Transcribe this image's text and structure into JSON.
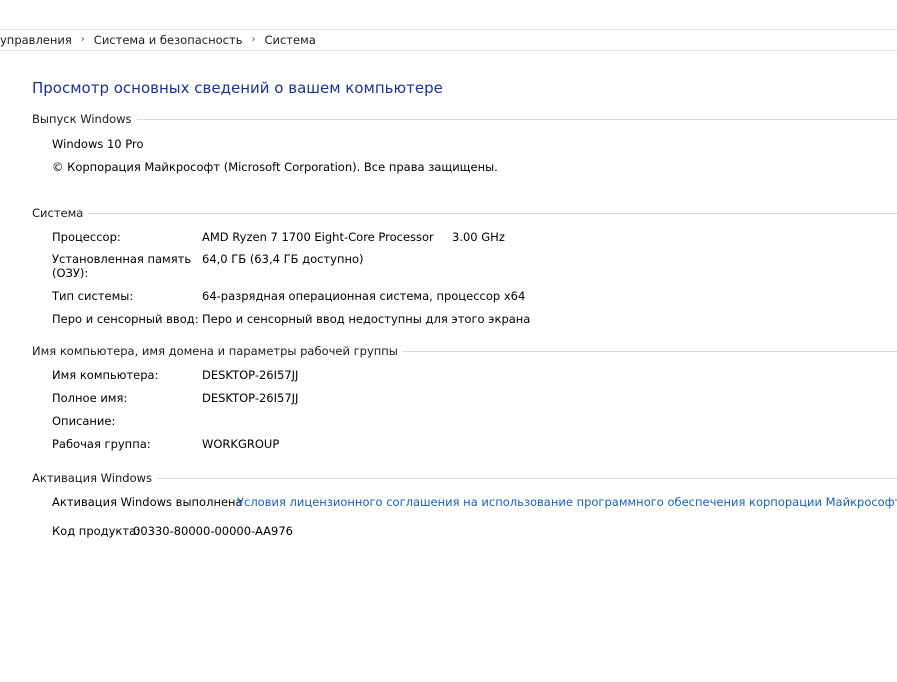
{
  "breadcrumb": {
    "items": [
      "управления",
      "Система и безопасность",
      "Система"
    ],
    "separator": "›"
  },
  "page_title": "Просмотр основных сведений о вашем компьютере",
  "windows_edition": {
    "header": "Выпуск Windows",
    "edition": "Windows 10 Pro",
    "copyright": "© Корпорация Майкрософт (Microsoft Corporation). Все права защищены."
  },
  "system": {
    "header": "Система",
    "processor_label": "Процессор:",
    "processor_value": "AMD Ryzen 7 1700 Eight-Core Processor",
    "processor_speed": "3.00 GHz",
    "ram_label_line1": "Установленная память",
    "ram_label_line2": "(ОЗУ):",
    "ram_value": "64,0 ГБ (63,4 ГБ доступно)",
    "type_label": "Тип системы:",
    "type_value": "64-разрядная операционная система, процессор x64",
    "pen_label": "Перо и сенсорный ввод:",
    "pen_value": "Перо и сенсорный ввод недоступны для этого экрана"
  },
  "computer_name": {
    "header": "Имя компьютера, имя домена и параметры рабочей группы",
    "name_label": "Имя компьютера:",
    "name_value": "DESKTOP-26I57JJ",
    "full_name_label": "Полное имя:",
    "full_name_value": "DESKTOP-26I57JJ",
    "description_label": "Описание:",
    "workgroup_label": "Рабочая группа:",
    "workgroup_value": "WORKGROUP"
  },
  "activation": {
    "header": "Активация Windows",
    "status": "Активация Windows выполнена",
    "license_link": "Условия лицензионного соглашения на использование программного обеспечения корпорации Майкрософт",
    "product_key_label": "Код продукта:",
    "product_key_value": "00330-80000-00000-AA976"
  },
  "colors": {
    "title": "#1e3287",
    "link": "#1a5fb4"
  }
}
